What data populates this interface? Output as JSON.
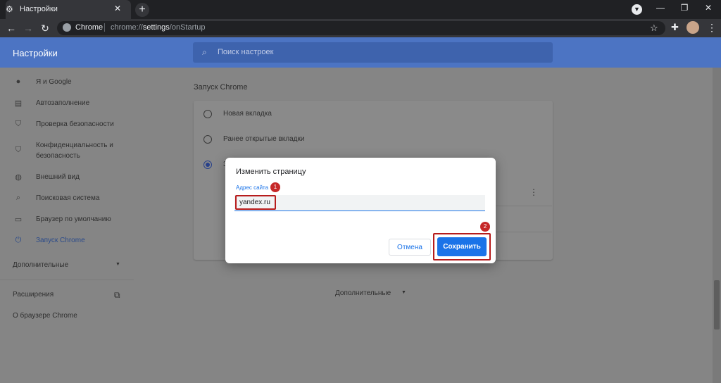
{
  "tab": {
    "title": "Настройки",
    "icon": "gear-icon"
  },
  "omnibox": {
    "site_name": "Chrome",
    "url_prefix": "chrome://",
    "url_host": "settings",
    "url_path": "/onStartup"
  },
  "settings": {
    "title": "Настройки",
    "search_placeholder": "Поиск настроек"
  },
  "sidebar": {
    "items": [
      {
        "label": "Я и Google",
        "icon": "person-icon"
      },
      {
        "label": "Автозаполнение",
        "icon": "clipboard-icon"
      },
      {
        "label": "Проверка безопасности",
        "icon": "shield-check-icon"
      },
      {
        "label": "Конфиденциальность и безопасность",
        "icon": "shield-icon"
      },
      {
        "label": "Внешний вид",
        "icon": "palette-icon"
      },
      {
        "label": "Поисковая система",
        "icon": "search-icon"
      },
      {
        "label": "Браузер по умолчанию",
        "icon": "browser-icon"
      },
      {
        "label": "Запуск Chrome",
        "icon": "power-icon"
      }
    ],
    "advanced": "Дополнительные",
    "extensions": "Расширения",
    "about": "О браузере Chrome"
  },
  "startup": {
    "section_title": "Запуск Chrome",
    "options": [
      "Новая вкладка",
      "Ранее открытые вкладки",
      "З"
    ],
    "selected_index": 2
  },
  "main_advanced": "Дополнительные",
  "dialog": {
    "title": "Изменить страницу",
    "field_label": "Адрес сайта",
    "field_value": "yandex.ru",
    "cancel": "Отмена",
    "save": "Сохранить",
    "badge_1": "1",
    "badge_2": "2",
    "highlight_color": "#b71c1c",
    "accent_color": "#1a73e8"
  }
}
